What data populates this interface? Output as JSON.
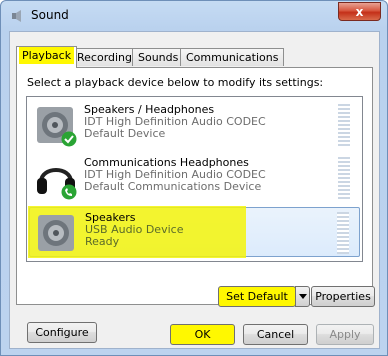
{
  "window": {
    "title": "Sound",
    "close_label": "x"
  },
  "tabs": [
    {
      "label": "Playback",
      "active": true
    },
    {
      "label": "Recording",
      "active": false
    },
    {
      "label": "Sounds",
      "active": false
    },
    {
      "label": "Communications",
      "active": false
    }
  ],
  "instruction": "Select a playback device below to modify its settings:",
  "devices": [
    {
      "name": "Speakers / Headphones",
      "driver": "IDT High Definition Audio CODEC",
      "status": "Default Device",
      "icon": "speaker-icon",
      "badge": "green-check-icon"
    },
    {
      "name": "Communications Headphones",
      "driver": "IDT High Definition Audio CODEC",
      "status": "Default Communications Device",
      "icon": "headphones-icon",
      "badge": "green-phone-icon"
    },
    {
      "name": "Speakers",
      "driver": "USB Audio Device",
      "status": "Ready",
      "icon": "speaker-icon",
      "selected": true
    }
  ],
  "buttons": {
    "configure": "Configure",
    "set_default": "Set Default",
    "properties": "Properties",
    "ok": "OK",
    "cancel": "Cancel",
    "apply": "Apply"
  },
  "colors": {
    "highlight": "#fff800",
    "selection": "#dcebfc"
  }
}
